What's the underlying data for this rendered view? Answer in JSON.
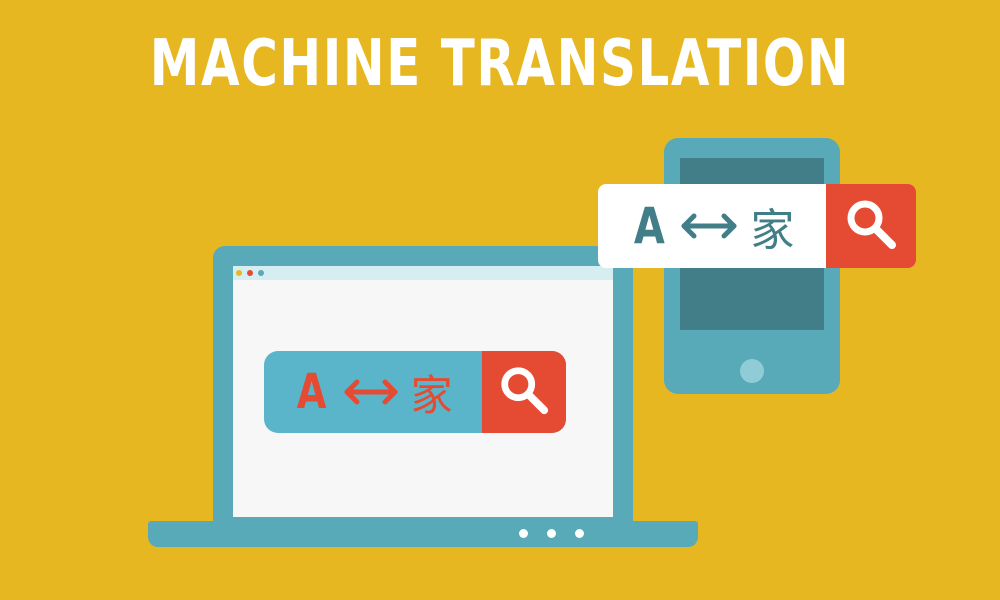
{
  "title": "MACHINE TRANSLATION",
  "colors": {
    "background": "#E7B721",
    "device": "#58AAB8",
    "phone_screen": "#417E87",
    "accent_red": "#E54B32",
    "laptop_search_field": "#5BB5CA",
    "white": "#FFFFFF"
  },
  "phone_search": {
    "source_letter": "A",
    "target_glyph": "家",
    "arrow_icon": "double-arrow-icon",
    "button_icon": "search-icon"
  },
  "laptop_search": {
    "source_letter": "A",
    "target_glyph": "家",
    "arrow_icon": "double-arrow-icon",
    "button_icon": "search-icon"
  }
}
